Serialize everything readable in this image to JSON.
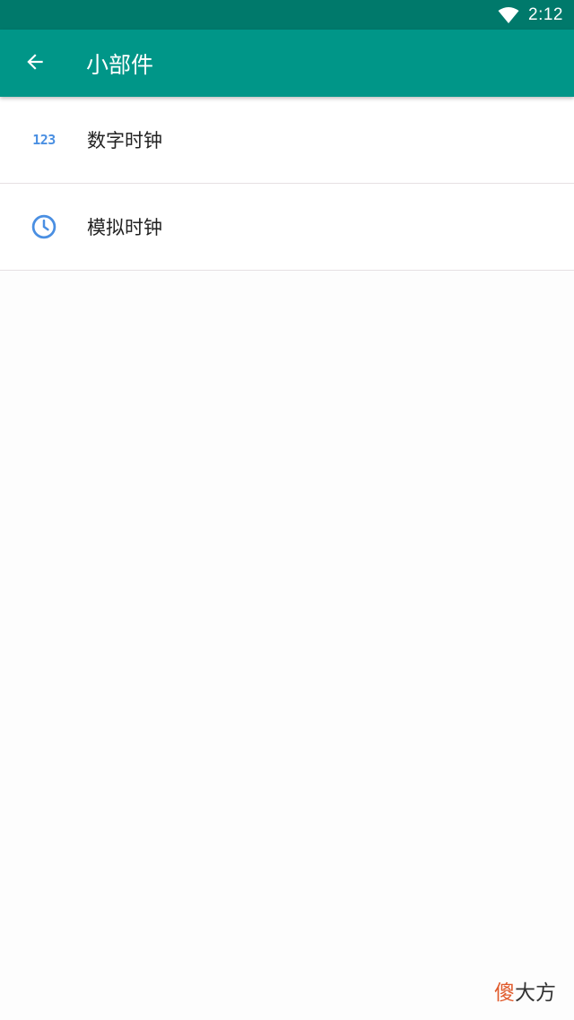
{
  "status_bar": {
    "time": "2:12",
    "icons": [
      "wifi-icon"
    ]
  },
  "app_bar": {
    "title": "小部件",
    "back_icon": "arrow-back-icon",
    "color": "#009688",
    "status_color": "#00796b"
  },
  "list": {
    "items": [
      {
        "label": "数字时钟",
        "icon": "digits-123-icon",
        "icon_text": "123"
      },
      {
        "label": "模拟时钟",
        "icon": "clock-icon"
      }
    ]
  },
  "watermark": {
    "accent_char": "傻",
    "rest": "大方"
  },
  "colors": {
    "icon_blue": "#4a8fe2",
    "divider": "#e6e0e3"
  }
}
